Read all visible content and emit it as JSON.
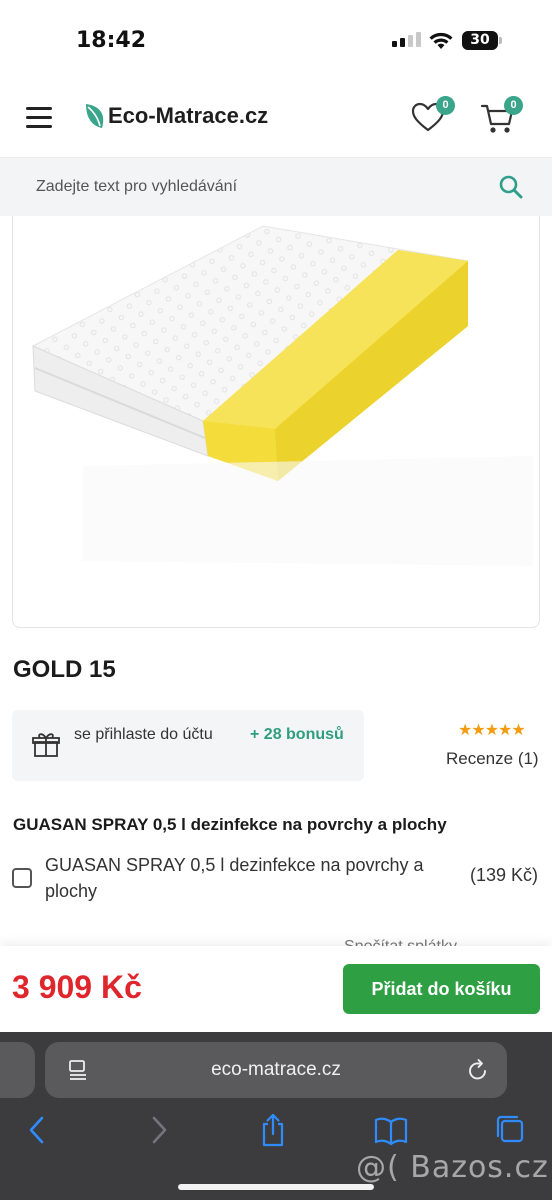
{
  "status_bar": {
    "time": "18:42",
    "battery": "30"
  },
  "header": {
    "logo_text": "Eco-Matrace.cz",
    "wishlist_count": "0",
    "cart_count": "0"
  },
  "search": {
    "placeholder": "Zadejte text pro vyhledávání"
  },
  "product": {
    "title": "GOLD 15",
    "bonus_text": "se přihlaste do účtu",
    "bonus_amount": "+ 28 bonusů",
    "stars": "★★★★★",
    "rating": 5,
    "reviews": "Recenze (1)"
  },
  "addon": {
    "heading": "GUASAN SPRAY 0,5 l dezinfekce na povrchy a plochy",
    "label": "GUASAN SPRAY 0,5 l dezinfekce na povrchy a plochy",
    "price": "(139 Kč)",
    "checked": false
  },
  "faded_text": "Spočítat splátky",
  "buy": {
    "price": "3 909 Kč",
    "button_label": "Přidat do košíku"
  },
  "browser": {
    "url": "eco-matrace.cz"
  },
  "watermark": "@( Bazos.cz",
  "colors": {
    "brand_green": "#3aa58a",
    "button_green": "#2ea043",
    "price_red": "#e0262d",
    "star": "#f39c12",
    "foam_yellow": "#f4dc3a"
  }
}
